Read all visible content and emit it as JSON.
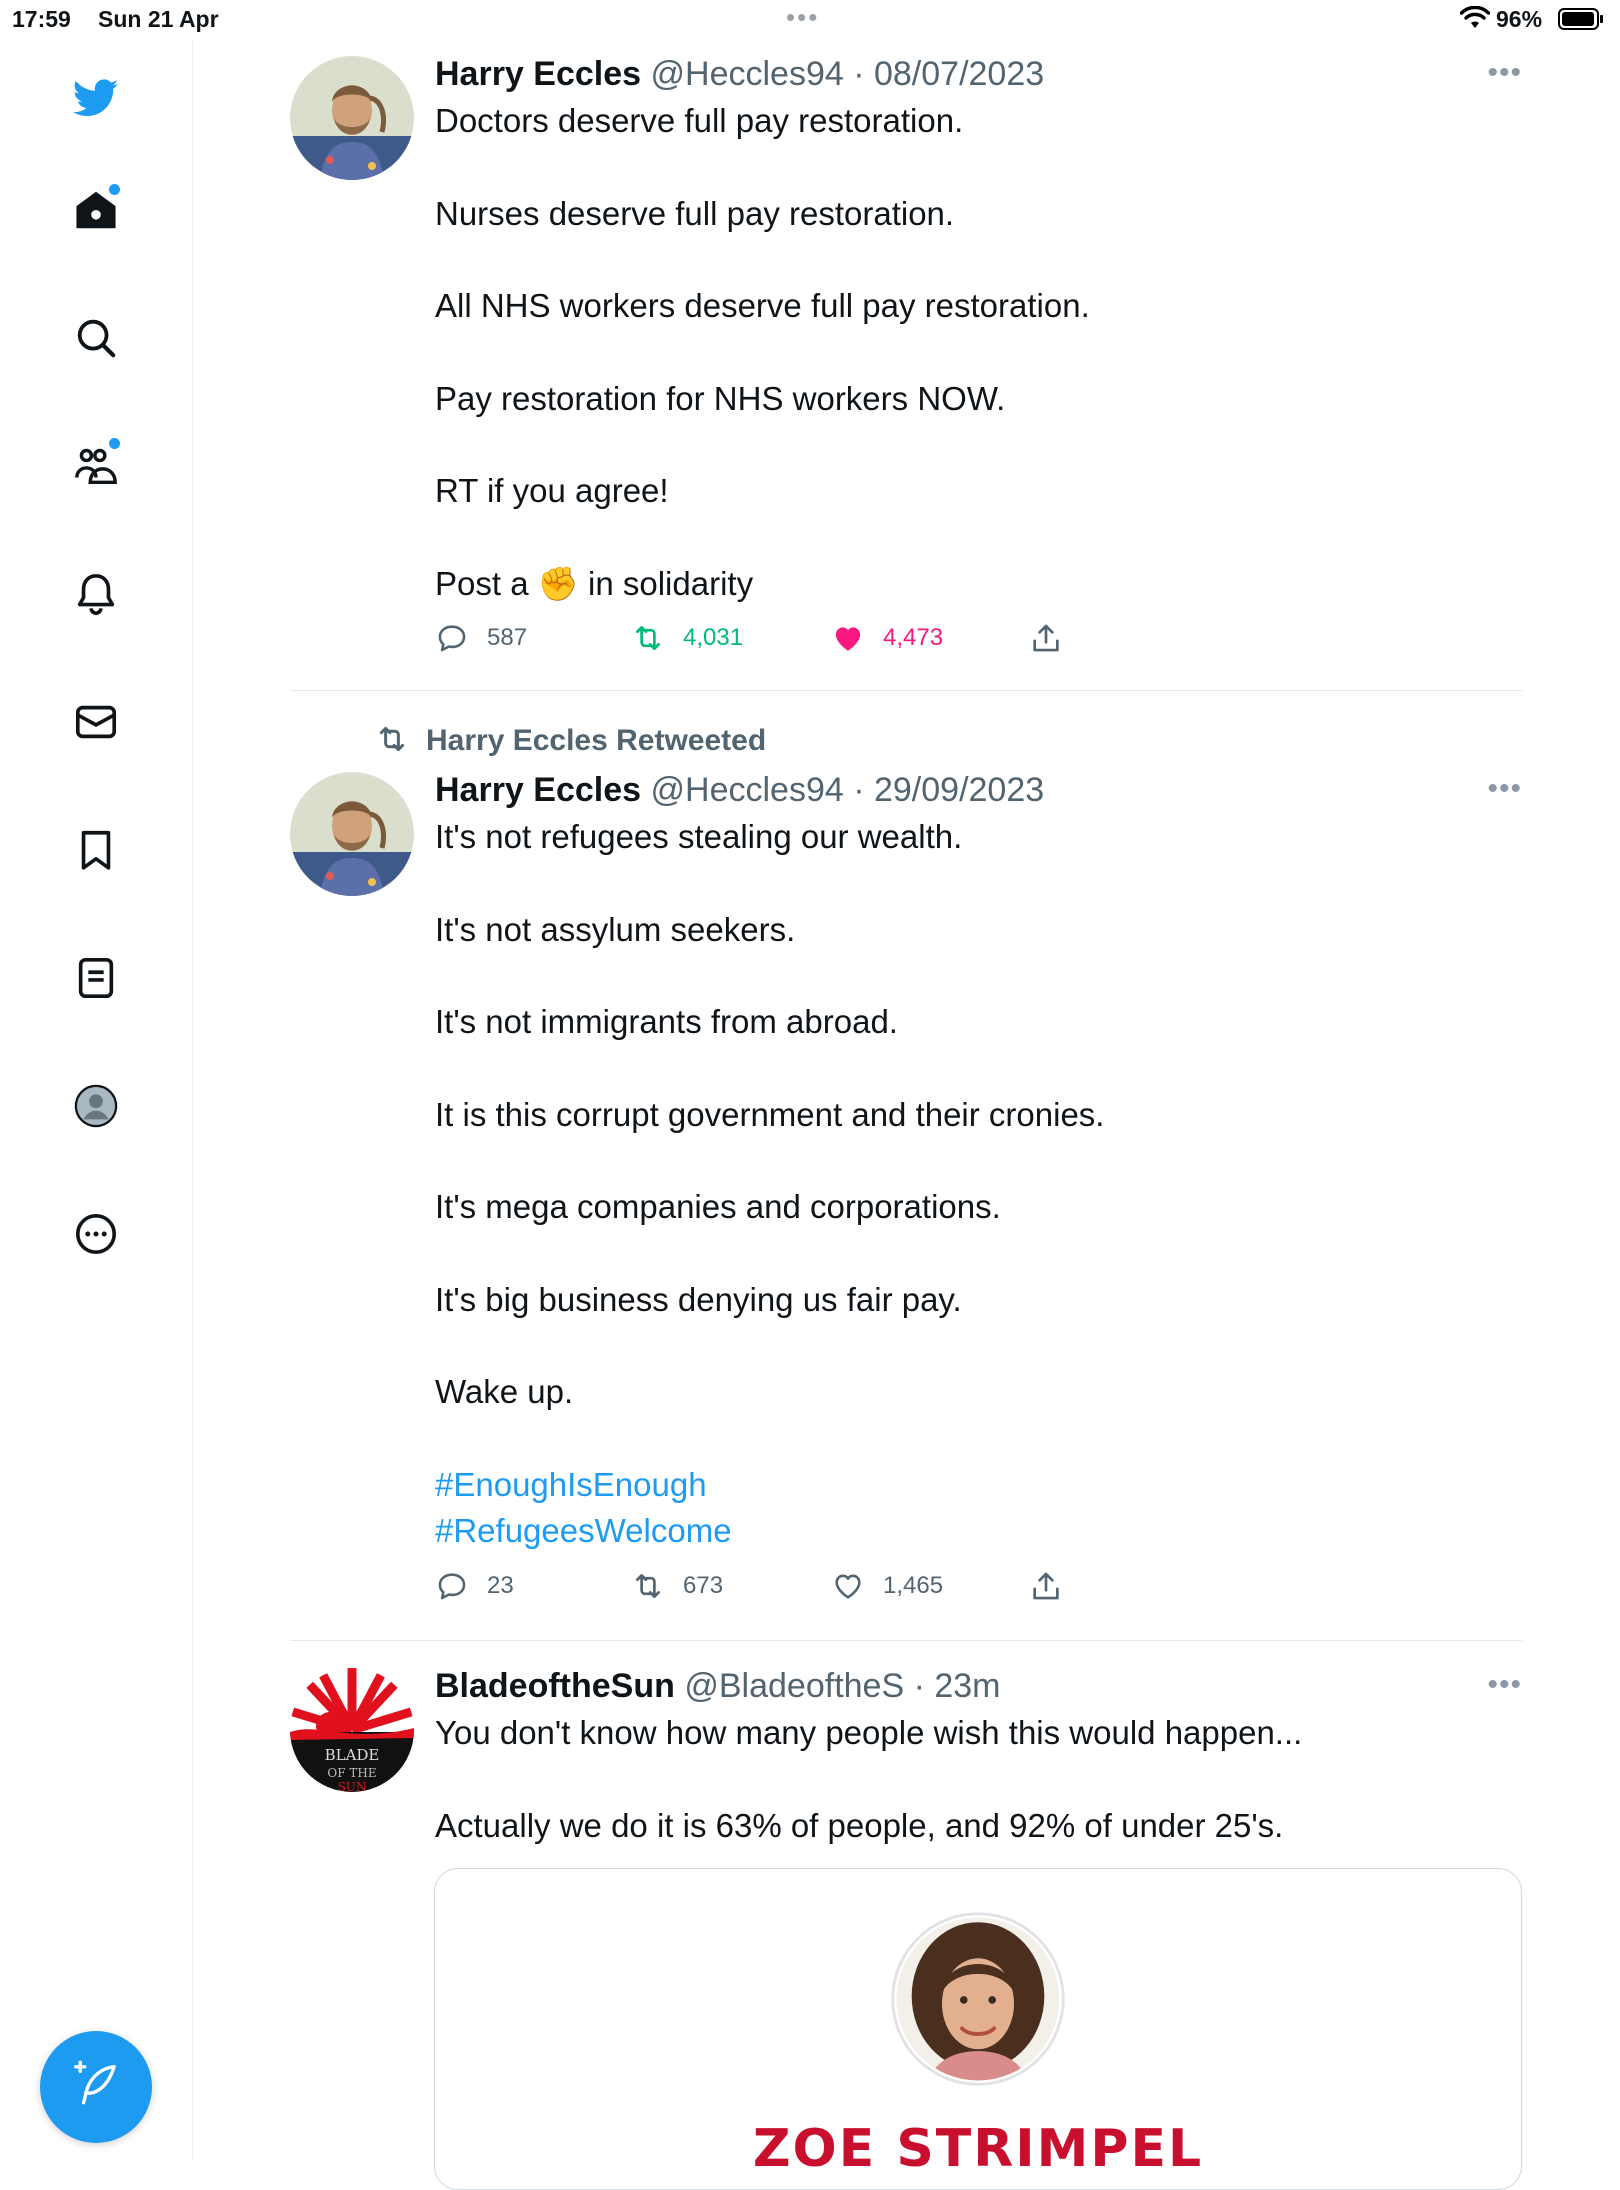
{
  "status_bar": {
    "time": "17:59",
    "date": "Sun 21 Apr",
    "battery": "96%"
  },
  "sidebar": {
    "items": [
      {
        "icon": "twitter-bird-icon"
      },
      {
        "icon": "home-icon",
        "badge": true
      },
      {
        "icon": "search-icon"
      },
      {
        "icon": "communities-icon",
        "badge": true
      },
      {
        "icon": "notifications-bell-icon"
      },
      {
        "icon": "messages-envelope-icon"
      },
      {
        "icon": "bookmarks-icon"
      },
      {
        "icon": "lists-icon"
      },
      {
        "icon": "profile-avatar-icon"
      },
      {
        "icon": "more-circle-icon"
      }
    ],
    "compose_icon": "compose-feather-icon",
    "accent": "#1d9bf0"
  },
  "tweets": [
    {
      "name": "Harry Eccles",
      "handle": "@Heccles94",
      "date": "08/07/2023",
      "lines": [
        "Doctors deserve full pay restoration.",
        "Nurses deserve full pay restoration.",
        "All NHS workers deserve full pay restoration.",
        "Pay restoration for NHS workers NOW.",
        "RT if you agree!"
      ],
      "last_line_before": "Post a",
      "last_line_emoji": "✊",
      "last_line_after": "in solidarity",
      "replies": "587",
      "retweets": "4,031",
      "likes": "4,473",
      "liked": true,
      "retweeted": true
    },
    {
      "retweet_label": "Harry Eccles Retweeted",
      "name": "Harry Eccles",
      "handle": "@Heccles94",
      "date": "29/09/2023",
      "lines": [
        "It's not refugees stealing our wealth.",
        "It's not assylum seekers.",
        "It's not immigrants from abroad.",
        "It is this corrupt government and their cronies.",
        "It's mega companies and corporations.",
        "It's big business denying us fair pay.",
        "Wake up."
      ],
      "hashtags": [
        "#EnoughIsEnough",
        "#RefugeesWelcome"
      ],
      "replies": "23",
      "retweets": "673",
      "likes": "1,465"
    },
    {
      "name": "BladeoftheSun",
      "handle": "@BladeoftheS",
      "date": "23m",
      "lines": [
        "You don't know how many people wish this would happen...",
        "Actually we do it is 63% of people, and 92% of under 25's."
      ],
      "card_title": "ZOE STRIMPEL",
      "avatar_text": [
        "BLADE",
        "OF THE",
        "SUN"
      ]
    }
  ],
  "colors": {
    "like": "#f91880",
    "retweet": "#00ba7c",
    "link": "#1d9bf0",
    "muted": "#536471"
  }
}
